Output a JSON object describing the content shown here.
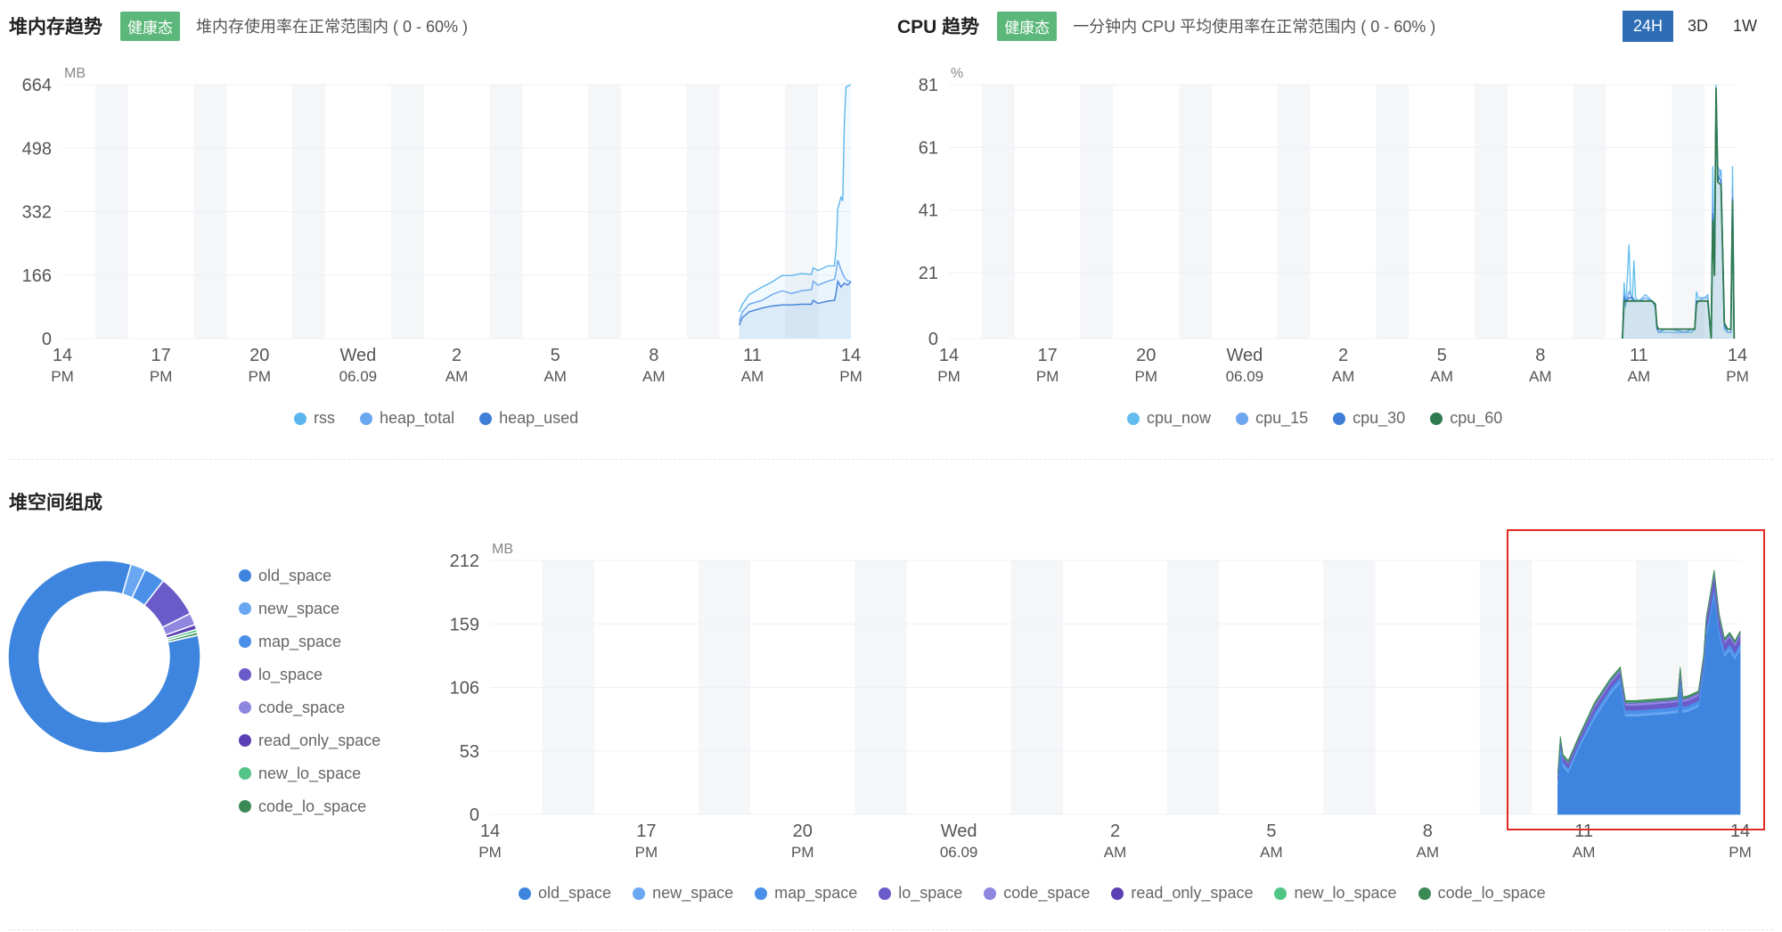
{
  "heap_panel": {
    "title": "堆内存趋势",
    "badge": "健康态",
    "desc": "堆内存使用率在正常范围内 ( 0 - 60% )"
  },
  "cpu_panel": {
    "title": "CPU 趋势",
    "badge": "健康态",
    "desc": "一分钟内 CPU 平均使用率在正常范围内 ( 0 - 60% )"
  },
  "range": {
    "options": [
      "24H",
      "3D",
      "1W"
    ],
    "selected": "24H"
  },
  "heap_space_section": {
    "title": "堆空间组成"
  },
  "colors": {
    "badge": "#5cb87a",
    "active_button": "#2f6db5",
    "shade": "#f5f6f8",
    "grid": "#eef0f3",
    "axis_text": "#555555",
    "rss": "#5bb6ee",
    "heap_total": "#6ba8f0",
    "heap_used": "#3f7fd8",
    "cpu_now": "#62bdee",
    "cpu_15": "#6ea6ef",
    "cpu_30": "#3f7fd8",
    "cpu_60": "#2f7a4f",
    "old_space": "#3d85de",
    "new_space": "#6aa7f2",
    "map_space": "#4a90e8",
    "lo_space": "#6a5bc9",
    "code_space": "#8f86e0",
    "read_only_space": "#5b3fb5",
    "new_lo_space": "#52c486",
    "code_lo_space": "#3b8a55",
    "highlight": "#e02b20"
  },
  "chart_data": [
    {
      "id": "heap_memory",
      "type": "line",
      "ylabel": "MB",
      "ylim": [
        0,
        664
      ],
      "yticks": [
        0,
        166,
        332,
        498,
        664
      ],
      "x_range": [
        0,
        24
      ],
      "x_ticks": [
        {
          "x": 0,
          "l1": "14",
          "l2": "PM"
        },
        {
          "x": 3,
          "l1": "17",
          "l2": "PM"
        },
        {
          "x": 6,
          "l1": "20",
          "l2": "PM"
        },
        {
          "x": 9,
          "l1": "Wed",
          "l2": "06.09"
        },
        {
          "x": 12,
          "l1": "2",
          "l2": "AM"
        },
        {
          "x": 15,
          "l1": "5",
          "l2": "AM"
        },
        {
          "x": 18,
          "l1": "8",
          "l2": "AM"
        },
        {
          "x": 21,
          "l1": "11",
          "l2": "AM"
        },
        {
          "x": 24,
          "l1": "14",
          "l2": "PM"
        }
      ],
      "series": [
        {
          "name": "rss",
          "x": [
            20.6,
            20.7,
            20.9,
            21.3,
            21.6,
            21.9,
            22.2,
            22.5,
            22.8,
            22.85,
            23.0,
            23.3,
            23.5,
            23.55,
            23.6,
            23.7,
            23.75,
            23.8,
            23.85,
            23.9,
            24.0
          ],
          "y": [
            70,
            90,
            115,
            135,
            148,
            165,
            165,
            170,
            168,
            185,
            178,
            190,
            190,
            235,
            340,
            370,
            360,
            560,
            658,
            660,
            664
          ]
        },
        {
          "name": "heap_total",
          "x": [
            20.6,
            20.7,
            20.9,
            21.3,
            21.6,
            21.9,
            22.2,
            22.5,
            22.8,
            22.85,
            23.0,
            23.3,
            23.5,
            23.55,
            23.6,
            23.7,
            23.8,
            23.9,
            24.0
          ],
          "y": [
            45,
            70,
            90,
            100,
            115,
            125,
            118,
            125,
            128,
            150,
            140,
            150,
            155,
            175,
            205,
            180,
            160,
            150,
            150
          ]
        },
        {
          "name": "heap_used",
          "x": [
            20.6,
            20.7,
            20.9,
            21.3,
            21.6,
            21.9,
            22.2,
            22.5,
            22.8,
            22.85,
            23.0,
            23.3,
            23.5,
            23.55,
            23.6,
            23.7,
            23.8,
            23.9,
            24.0
          ],
          "y": [
            35,
            55,
            70,
            80,
            85,
            88,
            88,
            90,
            90,
            100,
            92,
            98,
            100,
            120,
            150,
            135,
            145,
            140,
            148
          ]
        }
      ]
    },
    {
      "id": "cpu",
      "type": "line",
      "ylabel": "%",
      "ylim": [
        0,
        81
      ],
      "yticks": [
        0,
        21,
        41,
        61,
        81
      ],
      "x_range": [
        0,
        24
      ],
      "x_ticks": [
        {
          "x": 0,
          "l1": "14",
          "l2": "PM"
        },
        {
          "x": 3,
          "l1": "17",
          "l2": "PM"
        },
        {
          "x": 6,
          "l1": "20",
          "l2": "PM"
        },
        {
          "x": 9,
          "l1": "Wed",
          "l2": "06.09"
        },
        {
          "x": 12,
          "l1": "2",
          "l2": "AM"
        },
        {
          "x": 15,
          "l1": "5",
          "l2": "AM"
        },
        {
          "x": 18,
          "l1": "8",
          "l2": "AM"
        },
        {
          "x": 21,
          "l1": "11",
          "l2": "AM"
        },
        {
          "x": 24,
          "l1": "14",
          "l2": "PM"
        }
      ],
      "series": [
        {
          "name": "cpu_now",
          "x": [
            20.5,
            20.55,
            20.6,
            20.7,
            20.75,
            20.8,
            20.85,
            20.9,
            21.0,
            21.2,
            21.4,
            21.5,
            21.55,
            21.6,
            21.8,
            22.0,
            22.4,
            22.6,
            22.7,
            22.75,
            22.8,
            23.0,
            23.1,
            23.2,
            23.25,
            23.3,
            23.35,
            23.4,
            23.5,
            23.6,
            23.7,
            23.8,
            23.85,
            23.9
          ],
          "y": [
            0,
            18,
            10,
            30,
            14,
            12,
            25,
            13,
            12,
            14,
            12,
            10,
            3,
            2,
            2,
            2,
            2,
            2,
            3,
            15,
            13,
            13,
            14,
            0,
            55,
            20,
            81,
            50,
            54,
            3,
            2,
            2,
            55,
            0
          ]
        },
        {
          "name": "cpu_15",
          "x": [
            20.5,
            20.55,
            20.6,
            20.7,
            20.8,
            20.9,
            21.0,
            21.2,
            21.4,
            21.5,
            21.55,
            21.6,
            21.8,
            22.0,
            22.4,
            22.6,
            22.7,
            22.75,
            22.8,
            23.0,
            23.1,
            23.2,
            23.25,
            23.3,
            23.35,
            23.4,
            23.5,
            23.6,
            23.7,
            23.8,
            23.85,
            23.9
          ],
          "y": [
            0,
            14,
            11,
            15,
            13,
            12,
            12,
            13,
            12,
            11,
            3,
            2,
            3,
            3,
            2,
            3,
            3,
            12,
            12,
            13,
            13,
            0,
            45,
            25,
            79,
            55,
            52,
            4,
            2,
            2,
            48,
            0
          ]
        },
        {
          "name": "cpu_30",
          "x": [
            20.5,
            20.55,
            20.6,
            20.7,
            20.8,
            20.9,
            21.0,
            21.2,
            21.4,
            21.5,
            21.55,
            21.6,
            21.8,
            22.0,
            22.4,
            22.6,
            22.7,
            22.75,
            22.8,
            23.0,
            23.1,
            23.2,
            23.25,
            23.3,
            23.35,
            23.4,
            23.5,
            23.6,
            23.7,
            23.8,
            23.85,
            23.9
          ],
          "y": [
            0,
            13,
            12,
            13,
            13,
            12,
            12,
            12,
            12,
            11,
            3,
            3,
            3,
            3,
            3,
            3,
            3,
            12,
            12,
            12,
            12,
            0,
            40,
            22,
            77,
            52,
            50,
            4,
            3,
            3,
            45,
            0
          ]
        },
        {
          "name": "cpu_60",
          "x": [
            20.5,
            20.55,
            20.6,
            20.7,
            20.8,
            20.9,
            21.0,
            21.2,
            21.4,
            21.5,
            21.55,
            21.6,
            21.8,
            22.0,
            22.4,
            22.6,
            22.7,
            22.75,
            22.8,
            23.0,
            23.1,
            23.2,
            23.25,
            23.3,
            23.35,
            23.4,
            23.5,
            23.6,
            23.7,
            23.8,
            23.85,
            23.9
          ],
          "y": [
            0,
            12,
            12,
            12,
            12,
            12,
            12,
            12,
            12,
            11,
            4,
            3,
            3,
            3,
            3,
            3,
            3,
            11,
            12,
            12,
            12,
            0,
            38,
            20,
            80,
            50,
            49,
            5,
            3,
            3,
            44,
            0
          ]
        }
      ]
    },
    {
      "id": "heap_space_pie",
      "type": "pie",
      "labels": [
        "old_space",
        "new_space",
        "map_space",
        "lo_space",
        "code_space",
        "read_only_space",
        "new_lo_space",
        "code_lo_space"
      ],
      "values": [
        82.5,
        2.5,
        3.5,
        7.0,
        2.0,
        0.8,
        0.5,
        0.5
      ]
    },
    {
      "id": "heap_space_area",
      "type": "area",
      "ylabel": "MB",
      "ylim": [
        0,
        212
      ],
      "yticks": [
        0,
        53,
        106,
        159,
        212
      ],
      "x_range": [
        0,
        24
      ],
      "x_ticks": [
        {
          "x": 0,
          "l1": "14",
          "l2": "PM"
        },
        {
          "x": 3,
          "l1": "17",
          "l2": "PM"
        },
        {
          "x": 6,
          "l1": "20",
          "l2": "PM"
        },
        {
          "x": 9,
          "l1": "Wed",
          "l2": "06.09"
        },
        {
          "x": 12,
          "l1": "2",
          "l2": "AM"
        },
        {
          "x": 15,
          "l1": "5",
          "l2": "AM"
        },
        {
          "x": 18,
          "l1": "8",
          "l2": "AM"
        },
        {
          "x": 21,
          "l1": "11",
          "l2": "AM"
        },
        {
          "x": 24,
          "l1": "14",
          "l2": "PM"
        }
      ],
      "x": [
        20.5,
        20.55,
        20.6,
        20.7,
        20.9,
        21.2,
        21.5,
        21.7,
        21.75,
        21.8,
        22.0,
        22.3,
        22.6,
        22.8,
        22.85,
        22.9,
        23.0,
        23.2,
        23.3,
        23.35,
        23.4,
        23.5,
        23.6,
        23.7,
        23.8,
        23.9,
        24.0
      ],
      "series": [
        {
          "name": "old_space",
          "values": [
            25,
            55,
            40,
            35,
            55,
            80,
            100,
            110,
            95,
            82,
            82,
            83,
            84,
            85,
            110,
            85,
            86,
            90,
            120,
            150,
            160,
            185,
            150,
            132,
            137,
            130,
            138
          ]
        },
        {
          "name": "new_space",
          "values": [
            2,
            2,
            2,
            2,
            2,
            2,
            2,
            2,
            2,
            2,
            2,
            2,
            2,
            2,
            2,
            2,
            2,
            2,
            2,
            2,
            2,
            2,
            2,
            2,
            2,
            2,
            2
          ]
        },
        {
          "name": "map_space",
          "values": [
            2,
            2,
            2,
            2,
            2,
            3,
            3,
            3,
            3,
            3,
            3,
            3,
            3,
            3,
            3,
            3,
            3,
            3,
            3,
            3,
            3,
            3,
            3,
            3,
            3,
            3,
            3
          ]
        },
        {
          "name": "lo_space",
          "values": [
            3,
            3,
            3,
            3,
            3,
            4,
            4,
            4,
            4,
            4,
            4,
            4,
            4,
            4,
            4,
            4,
            4,
            4,
            4,
            6,
            8,
            10,
            8,
            6,
            6,
            6,
            6
          ]
        },
        {
          "name": "code_space",
          "values": [
            1,
            1,
            1,
            1,
            1,
            2,
            2,
            2,
            2,
            2,
            2,
            2,
            2,
            2,
            2,
            2,
            2,
            2,
            2,
            2,
            2,
            2,
            2,
            2,
            2,
            2,
            2
          ]
        },
        {
          "name": "read_only_space",
          "values": [
            0.5,
            0.5,
            0.5,
            0.5,
            0.5,
            0.5,
            0.5,
            0.5,
            0.5,
            0.5,
            0.5,
            0.5,
            0.5,
            0.5,
            0.5,
            0.5,
            0.5,
            0.5,
            0.5,
            0.5,
            0.5,
            0.5,
            0.5,
            0.5,
            0.5,
            0.5,
            0.5
          ]
        },
        {
          "name": "new_lo_space",
          "values": [
            0.5,
            0.5,
            0.5,
            0.5,
            0.5,
            0.5,
            0.5,
            0.5,
            0.5,
            0.5,
            0.5,
            0.5,
            0.5,
            0.5,
            0.5,
            0.5,
            0.5,
            0.5,
            0.5,
            0.5,
            0.5,
            0.5,
            0.5,
            0.5,
            0.5,
            0.5,
            0.5
          ]
        },
        {
          "name": "code_lo_space",
          "values": [
            1,
            1,
            1,
            1,
            1,
            1,
            1,
            1,
            1,
            1,
            1,
            1,
            1,
            1,
            1,
            1,
            1,
            1,
            1,
            1,
            1,
            1,
            1,
            1,
            1,
            1,
            1
          ]
        }
      ]
    }
  ]
}
